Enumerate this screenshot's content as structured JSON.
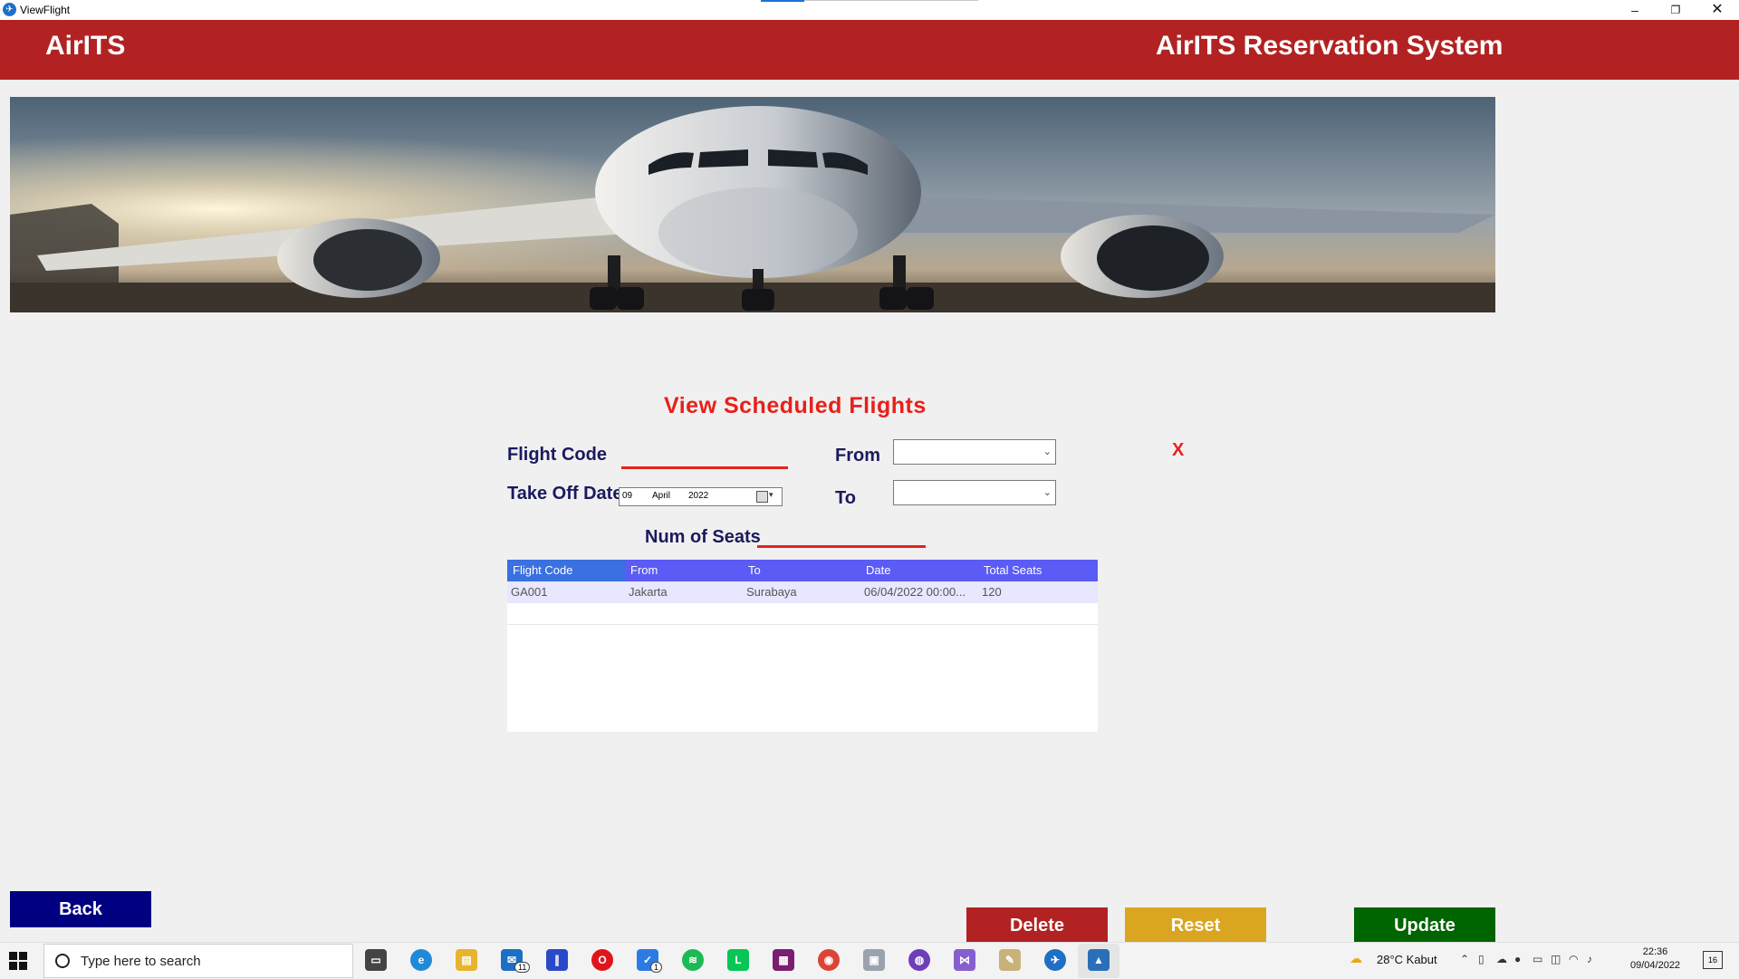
{
  "window": {
    "title": "ViewFlight",
    "minimize": "–",
    "maximize": "❐",
    "close": "✕"
  },
  "header": {
    "brand": "AirITS",
    "system_title": "AirITS Reservation System",
    "color": "#b22222"
  },
  "form": {
    "title": "View Scheduled Flights",
    "flight_code_label": "Flight Code",
    "flight_code_value": "",
    "takeoff_label": "Take Off Date",
    "date_day": "09",
    "date_month": "April",
    "date_year": "2022",
    "from_label": "From",
    "from_value": "",
    "to_label": "To",
    "to_value": "",
    "seats_label": "Num of Seats",
    "seats_value": "",
    "close_x": "X"
  },
  "grid": {
    "columns": [
      "Flight Code",
      "From",
      "To",
      "Date",
      "Total Seats"
    ],
    "rows": [
      [
        "GA001",
        "Jakarta",
        "Surabaya",
        "06/04/2022 00:00...",
        "120"
      ]
    ]
  },
  "buttons": {
    "back": "Back",
    "delete": "Delete",
    "reset": "Reset",
    "update": "Update",
    "colors": {
      "back": "#000080",
      "delete": "#b22222",
      "reset": "#daa520",
      "update": "#006400"
    }
  },
  "taskbar": {
    "search_placeholder": "Type here to search",
    "weather": "28°C  Kabut",
    "time": "22:36",
    "date": "09/04/2022",
    "notifications": "16",
    "mail_badge": "11",
    "todo_badge": "1",
    "pinned_icons": [
      "task-view-icon",
      "edge-icon",
      "file-explorer-icon",
      "mail-icon",
      "app-icon",
      "opera-icon",
      "todo-icon",
      "spotify-icon",
      "line-icon",
      "winrar-icon",
      "chrome-icon",
      "photos-viewer-icon",
      "github-icon",
      "visual-studio-icon",
      "paint-icon",
      "airits-app-icon",
      "photos-icon"
    ]
  }
}
